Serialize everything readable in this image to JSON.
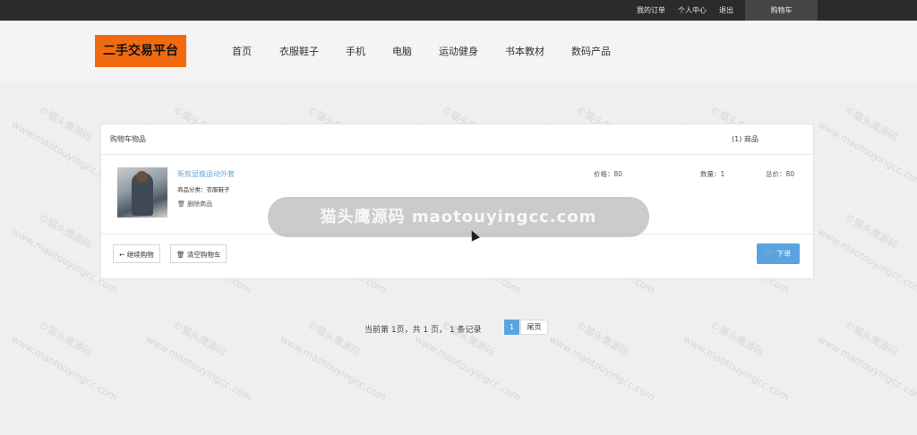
{
  "topbar": {
    "my_orders": "我的订单",
    "profile": "个人中心",
    "logout": "退出",
    "cart": "购物车"
  },
  "header": {
    "logo": "二手交易平台",
    "nav": [
      "首页",
      "衣服鞋子",
      "手机",
      "电脑",
      "运动健身",
      "书本教材",
      "数码产品"
    ]
  },
  "cart": {
    "title": "购物车物品",
    "count": "(1) 商品",
    "item": {
      "name": "新款显瘦运动外套",
      "category": "商品分类：衣服鞋子",
      "delete": "删除商品",
      "price": "价格：80",
      "quantity": "数量：1",
      "total": "总价：80"
    },
    "continue_label": "继续购物",
    "clear_label": "清空购物车",
    "order_label": "下单"
  },
  "pagination": {
    "summary": "当前第 1页，共 1 页，  1 条记录",
    "current": "1",
    "last": "尾页"
  },
  "watermark": {
    "banner": "猫头鹰源码 maotouyingcc.com",
    "tile_a": "©猫头鹰源码",
    "tile_b": "www.maotouyingcc.com"
  },
  "colors": {
    "accent": "#5ba3e0",
    "logo_bg": "#f26a10",
    "topbar_bg": "#2b2b2b"
  }
}
